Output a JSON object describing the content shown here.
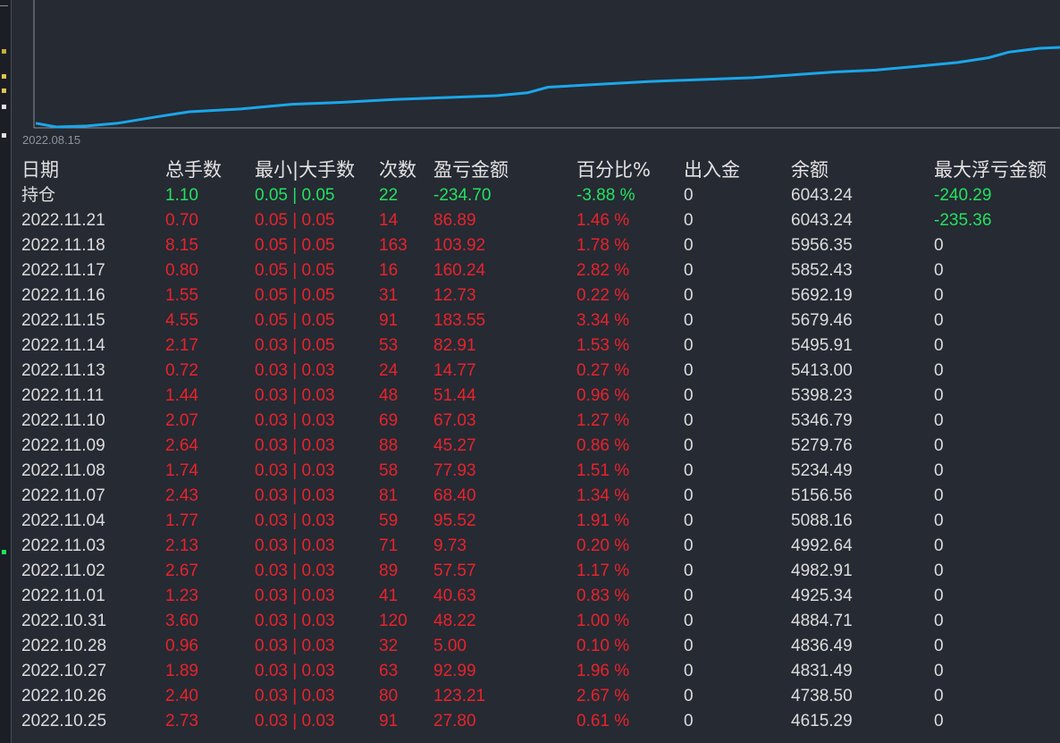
{
  "colors": {
    "background": "#262a33",
    "line": "#1aa7ea",
    "positive": "#e8232b",
    "negative": "#23e25f",
    "neutral": "#dcdcdc"
  },
  "chart": {
    "start_date_label": "2022.08.15",
    "equity_curve": [
      [
        0,
        0.04
      ],
      [
        0.02,
        0.0
      ],
      [
        0.05,
        0.01
      ],
      [
        0.08,
        0.04
      ],
      [
        0.12,
        0.11
      ],
      [
        0.15,
        0.16
      ],
      [
        0.2,
        0.19
      ],
      [
        0.25,
        0.24
      ],
      [
        0.3,
        0.26
      ],
      [
        0.35,
        0.29
      ],
      [
        0.4,
        0.31
      ],
      [
        0.45,
        0.33
      ],
      [
        0.48,
        0.36
      ],
      [
        0.5,
        0.42
      ],
      [
        0.55,
        0.45
      ],
      [
        0.6,
        0.48
      ],
      [
        0.65,
        0.5
      ],
      [
        0.7,
        0.52
      ],
      [
        0.74,
        0.55
      ],
      [
        0.78,
        0.58
      ],
      [
        0.82,
        0.6
      ],
      [
        0.86,
        0.64
      ],
      [
        0.9,
        0.68
      ],
      [
        0.93,
        0.73
      ],
      [
        0.95,
        0.79
      ],
      [
        0.98,
        0.83
      ],
      [
        1.0,
        0.84
      ]
    ]
  },
  "table": {
    "headers": [
      "日期",
      "总手数",
      "最小|大手数",
      "次数",
      "盈亏金额",
      "百分比%",
      "出入金",
      "余额",
      "最大浮亏金额"
    ],
    "rows": [
      {
        "date": "持仓",
        "lots": "1.10",
        "minmax": "0.05 | 0.05",
        "count": "22",
        "pnl": "-234.70",
        "pct": "-3.88 %",
        "cash": "0",
        "balance": "6043.24",
        "maxdd": "-240.29",
        "sign": "neg"
      },
      {
        "date": "2022.11.21",
        "lots": "0.70",
        "minmax": "0.05 | 0.05",
        "count": "14",
        "pnl": "86.89",
        "pct": "1.46 %",
        "cash": "0",
        "balance": "6043.24",
        "maxdd": "-235.36",
        "sign": "pos"
      },
      {
        "date": "2022.11.18",
        "lots": "8.15",
        "minmax": "0.05 | 0.05",
        "count": "163",
        "pnl": "103.92",
        "pct": "1.78 %",
        "cash": "0",
        "balance": "5956.35",
        "maxdd": "0",
        "sign": "pos"
      },
      {
        "date": "2022.11.17",
        "lots": "0.80",
        "minmax": "0.05 | 0.05",
        "count": "16",
        "pnl": "160.24",
        "pct": "2.82 %",
        "cash": "0",
        "balance": "5852.43",
        "maxdd": "0",
        "sign": "pos"
      },
      {
        "date": "2022.11.16",
        "lots": "1.55",
        "minmax": "0.05 | 0.05",
        "count": "31",
        "pnl": "12.73",
        "pct": "0.22 %",
        "cash": "0",
        "balance": "5692.19",
        "maxdd": "0",
        "sign": "pos"
      },
      {
        "date": "2022.11.15",
        "lots": "4.55",
        "minmax": "0.05 | 0.05",
        "count": "91",
        "pnl": "183.55",
        "pct": "3.34 %",
        "cash": "0",
        "balance": "5679.46",
        "maxdd": "0",
        "sign": "pos"
      },
      {
        "date": "2022.11.14",
        "lots": "2.17",
        "minmax": "0.03 | 0.05",
        "count": "53",
        "pnl": "82.91",
        "pct": "1.53 %",
        "cash": "0",
        "balance": "5495.91",
        "maxdd": "0",
        "sign": "pos"
      },
      {
        "date": "2022.11.13",
        "lots": "0.72",
        "minmax": "0.03 | 0.03",
        "count": "24",
        "pnl": "14.77",
        "pct": "0.27 %",
        "cash": "0",
        "balance": "5413.00",
        "maxdd": "0",
        "sign": "pos"
      },
      {
        "date": "2022.11.11",
        "lots": "1.44",
        "minmax": "0.03 | 0.03",
        "count": "48",
        "pnl": "51.44",
        "pct": "0.96 %",
        "cash": "0",
        "balance": "5398.23",
        "maxdd": "0",
        "sign": "pos"
      },
      {
        "date": "2022.11.10",
        "lots": "2.07",
        "minmax": "0.03 | 0.03",
        "count": "69",
        "pnl": "67.03",
        "pct": "1.27 %",
        "cash": "0",
        "balance": "5346.79",
        "maxdd": "0",
        "sign": "pos"
      },
      {
        "date": "2022.11.09",
        "lots": "2.64",
        "minmax": "0.03 | 0.03",
        "count": "88",
        "pnl": "45.27",
        "pct": "0.86 %",
        "cash": "0",
        "balance": "5279.76",
        "maxdd": "0",
        "sign": "pos"
      },
      {
        "date": "2022.11.08",
        "lots": "1.74",
        "minmax": "0.03 | 0.03",
        "count": "58",
        "pnl": "77.93",
        "pct": "1.51 %",
        "cash": "0",
        "balance": "5234.49",
        "maxdd": "0",
        "sign": "pos"
      },
      {
        "date": "2022.11.07",
        "lots": "2.43",
        "minmax": "0.03 | 0.03",
        "count": "81",
        "pnl": "68.40",
        "pct": "1.34 %",
        "cash": "0",
        "balance": "5156.56",
        "maxdd": "0",
        "sign": "pos"
      },
      {
        "date": "2022.11.04",
        "lots": "1.77",
        "minmax": "0.03 | 0.03",
        "count": "59",
        "pnl": "95.52",
        "pct": "1.91 %",
        "cash": "0",
        "balance": "5088.16",
        "maxdd": "0",
        "sign": "pos"
      },
      {
        "date": "2022.11.03",
        "lots": "2.13",
        "minmax": "0.03 | 0.03",
        "count": "71",
        "pnl": "9.73",
        "pct": "0.20 %",
        "cash": "0",
        "balance": "4992.64",
        "maxdd": "0",
        "sign": "pos"
      },
      {
        "date": "2022.11.02",
        "lots": "2.67",
        "minmax": "0.03 | 0.03",
        "count": "89",
        "pnl": "57.57",
        "pct": "1.17 %",
        "cash": "0",
        "balance": "4982.91",
        "maxdd": "0",
        "sign": "pos"
      },
      {
        "date": "2022.11.01",
        "lots": "1.23",
        "minmax": "0.03 | 0.03",
        "count": "41",
        "pnl": "40.63",
        "pct": "0.83 %",
        "cash": "0",
        "balance": "4925.34",
        "maxdd": "0",
        "sign": "pos"
      },
      {
        "date": "2022.10.31",
        "lots": "3.60",
        "minmax": "0.03 | 0.03",
        "count": "120",
        "pnl": "48.22",
        "pct": "1.00 %",
        "cash": "0",
        "balance": "4884.71",
        "maxdd": "0",
        "sign": "pos"
      },
      {
        "date": "2022.10.28",
        "lots": "0.96",
        "minmax": "0.03 | 0.03",
        "count": "32",
        "pnl": "5.00",
        "pct": "0.10 %",
        "cash": "0",
        "balance": "4836.49",
        "maxdd": "0",
        "sign": "pos"
      },
      {
        "date": "2022.10.27",
        "lots": "1.89",
        "minmax": "0.03 | 0.03",
        "count": "63",
        "pnl": "92.99",
        "pct": "1.96 %",
        "cash": "0",
        "balance": "4831.49",
        "maxdd": "0",
        "sign": "pos"
      },
      {
        "date": "2022.10.26",
        "lots": "2.40",
        "minmax": "0.03 | 0.03",
        "count": "80",
        "pnl": "123.21",
        "pct": "2.67 %",
        "cash": "0",
        "balance": "4738.50",
        "maxdd": "0",
        "sign": "pos"
      },
      {
        "date": "2022.10.25",
        "lots": "2.73",
        "minmax": "0.03 | 0.03",
        "count": "91",
        "pnl": "27.80",
        "pct": "0.61 %",
        "cash": "0",
        "balance": "4615.29",
        "maxdd": "0",
        "sign": "pos"
      }
    ]
  }
}
